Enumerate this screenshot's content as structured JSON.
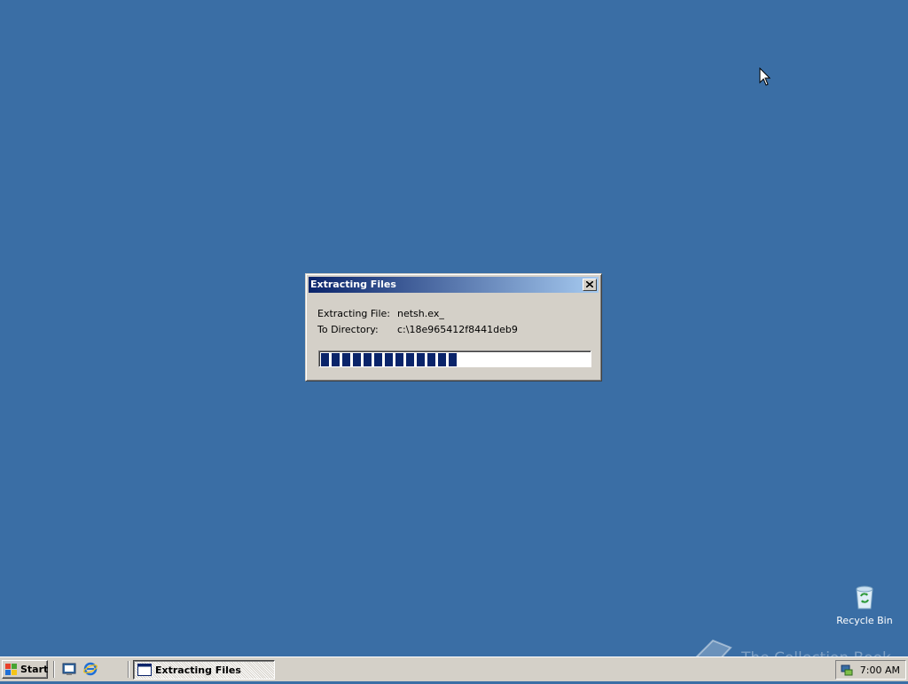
{
  "dialog": {
    "title": "Extracting Files",
    "close_label": "×",
    "extracting_label": "Extracting File:",
    "extracting_value": "netsh.ex_",
    "directory_label": "To Directory:",
    "directory_value": "c:\\18e965412f8441deb9",
    "progress_percent": 53
  },
  "desktop": {
    "recycle_bin_label": "Recycle Bin"
  },
  "taskbar": {
    "start_label": "Start",
    "quick_launch": [
      "show-desktop-icon",
      "internet-explorer-icon"
    ],
    "task_label": "Extracting Files",
    "clock": "7:00 AM"
  },
  "watermark": {
    "text": "The Collection Book"
  },
  "colors": {
    "desktop": "#3a6ea5",
    "title_start": "#0a246a",
    "title_end": "#a6caf0",
    "progress_block": "#0a246a"
  }
}
